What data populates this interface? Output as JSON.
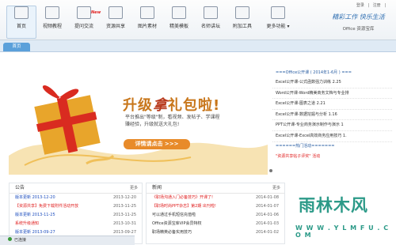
{
  "toolbar": {
    "items": [
      {
        "label": "首页"
      },
      {
        "label": "视频教程"
      },
      {
        "label": "提问交流"
      },
      {
        "label": "资源共享"
      },
      {
        "label": "图片素材"
      },
      {
        "label": "精美模板"
      },
      {
        "label": "名师讲坛"
      },
      {
        "label": "附加工具"
      },
      {
        "label": "更多功能 ▾"
      }
    ],
    "new_badge": "New",
    "links": [
      "登录",
      "|",
      "注册",
      "|"
    ],
    "brand_slogan": "精彩工作  快乐生活",
    "brand_name": "Office 资源宝库"
  },
  "tab": {
    "label": "首页"
  },
  "banner": {
    "title_a": "升级",
    "title_b": "拿",
    "title_c": "礼包",
    "title_d": "啦!",
    "desc_line1": "平台推出\"等级\"制，看视频、发帖子、学课程",
    "desc_line2": "赚经验，升级就送大礼包!",
    "button": "详情请点击 >>>",
    "colors": {
      "gift": "#e8a52b",
      "ribbon": "#d92b20",
      "swirl": "#f0c05a"
    }
  },
  "panel": {
    "header": "===Office公开课 ( 2014年1-6月 ) ===",
    "courses": [
      "Excel公开课-公式函数强力训练 2.25",
      "Word公开课-Word精美商务文档与专业排",
      "Excel公开课-图表之道 2.21",
      "Excel公开课-数据挖掘与分析 1.16",
      "PPT公开课-专业商务演示制作与演示 1",
      "Excel公开课-Excel高效商务应用技巧 1."
    ],
    "hot_header": "======热门活动=======",
    "promo": "\"资源共享帖子评奖\" 活动"
  },
  "notice": {
    "title": "公告",
    "more": "更多",
    "rows": [
      {
        "text": "版本更新  2013-12-20",
        "date": "2013-12-20",
        "color": "blue"
      },
      {
        "text": "【资源共享】免费下载附件活动开放",
        "date": "2013-11-25",
        "color": "red"
      },
      {
        "text": "版本更新  2013-11-25",
        "date": "2013-11-25",
        "color": "blue"
      },
      {
        "text": "系统升级通知",
        "date": "2013-10-31",
        "color": "red"
      },
      {
        "text": "版本更新  2013-09-27",
        "date": "2013-09-27",
        "color": "blue"
      }
    ]
  },
  "news": {
    "title": "新闻",
    "more": "更多",
    "rows": [
      {
        "text": "《职场沟通入门必备技巧》开课了!",
        "date": "2014-01-08",
        "color": "red"
      },
      {
        "text": "【职场时尚PPT杂志】第2期 出刊啦!",
        "date": "2014-01-07",
        "color": "red"
      },
      {
        "text": "可以通过手机短信充值啦",
        "date": "2014-01-06",
        "color": "plain"
      },
      {
        "text": "Office资源宝库VIP会员特权",
        "date": "2014-01-03",
        "color": "plain"
      },
      {
        "text": "职场精英必备实用技巧",
        "date": "2014-01-02",
        "color": "plain"
      }
    ]
  },
  "status": {
    "text": "已连接"
  },
  "watermark": {
    "logo": "雨林木风",
    "url": "W W W . Y L M F U . C O M"
  }
}
